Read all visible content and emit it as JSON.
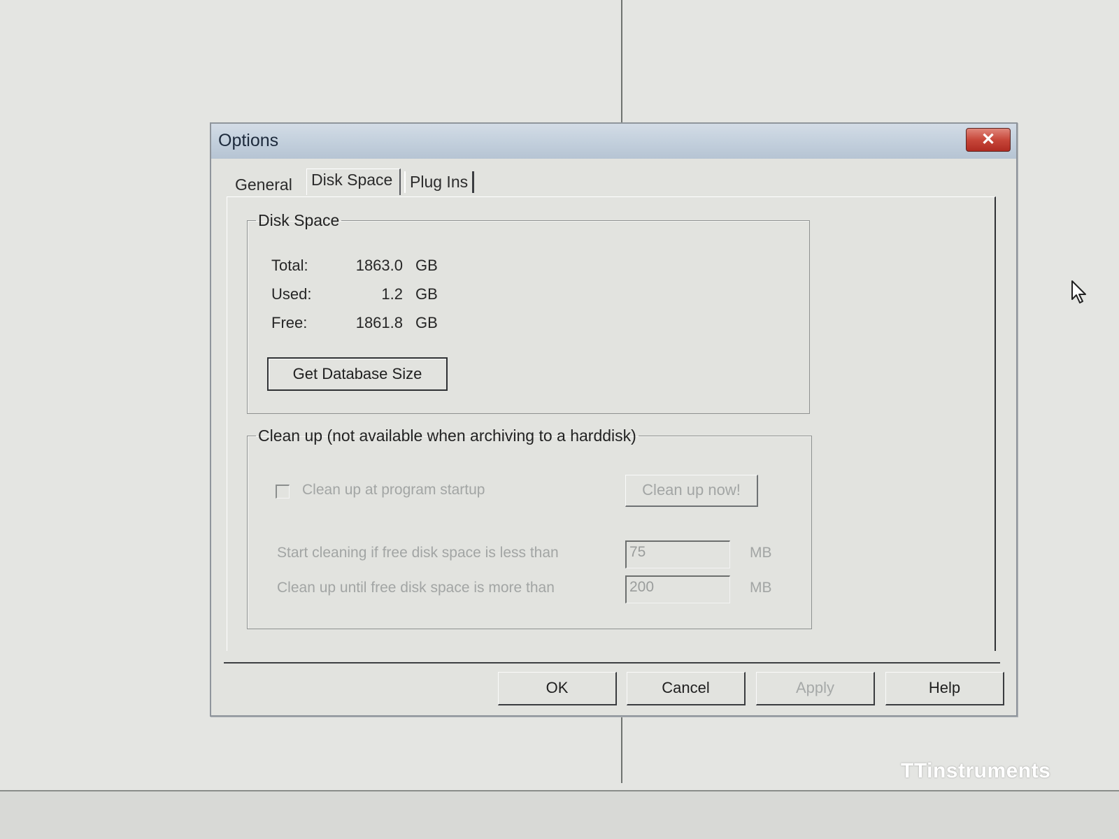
{
  "dialog": {
    "title": "Options",
    "close_glyph": "✕"
  },
  "tabs": [
    {
      "label": "General",
      "active": false
    },
    {
      "label": "Disk Space",
      "active": true
    },
    {
      "label": "Plug Ins",
      "active": false
    }
  ],
  "disk_space": {
    "legend": "Disk Space",
    "rows": [
      {
        "label": "Total:",
        "value": "1863.0",
        "unit": "GB"
      },
      {
        "label": "Used:",
        "value": "1.2",
        "unit": "GB"
      },
      {
        "label": "Free:",
        "value": "1861.8",
        "unit": "GB"
      }
    ],
    "get_db_size_label": "Get Database Size"
  },
  "cleanup": {
    "legend": "Clean up (not available when archiving to a harddisk)",
    "startup_checkbox_label": "Clean up at program startup",
    "startup_checked": false,
    "clean_now_label": "Clean up now!",
    "start_label": "Start cleaning if free disk space is less than",
    "start_value": "75",
    "start_unit": "MB",
    "until_label": "Clean up until free disk space is more than",
    "until_value": "200",
    "until_unit": "MB",
    "enabled": false
  },
  "footer": {
    "ok_label": "OK",
    "cancel_label": "Cancel",
    "apply_label": "Apply",
    "help_label": "Help"
  },
  "watermark": "TTinstruments",
  "colors": {
    "titlebar": "#c2cfdc",
    "close_button": "#c7473a",
    "dialog_face": "#e2e3df",
    "disabled_text": "#a2a5a4"
  },
  "icons": {
    "close": "close-icon",
    "cursor": "mouse-pointer-icon"
  }
}
